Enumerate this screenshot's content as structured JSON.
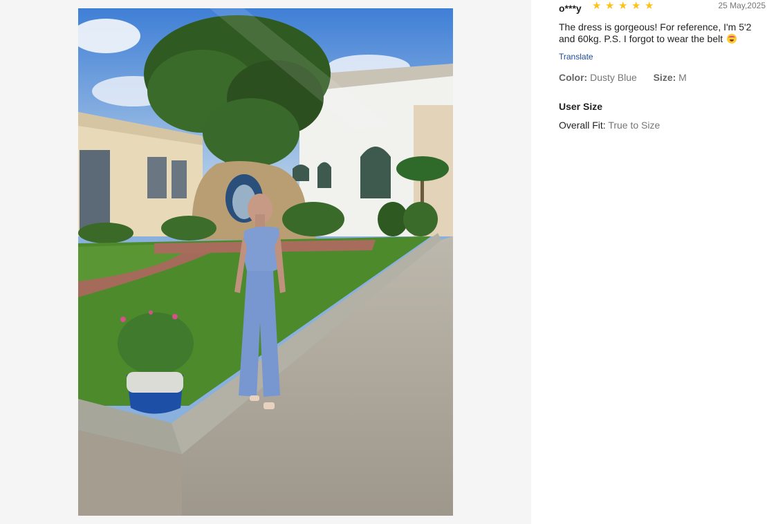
{
  "review": {
    "reviewer": "o***y",
    "rating": 5,
    "date": "25 May,2025",
    "text": "The dress is gorgeous! For reference, I'm 5'2 and 60kg. P.S. I forgot to wear the belt",
    "emoji_icon": "heart-eyes-emoji",
    "translate_label": "Translate",
    "color_label": "Color:",
    "color_value": "Dusty Blue",
    "size_label": "Size:",
    "size_value": "M"
  },
  "user_size": {
    "title": "User Size",
    "fit_label": "Overall Fit:",
    "fit_value": "True to Size"
  },
  "colors": {
    "star": "#fcc21a",
    "link": "#1f4a99",
    "panel_bg": "#f5f5f5"
  },
  "stars": [
    "star-icon",
    "star-icon",
    "star-icon",
    "star-icon",
    "star-icon"
  ]
}
